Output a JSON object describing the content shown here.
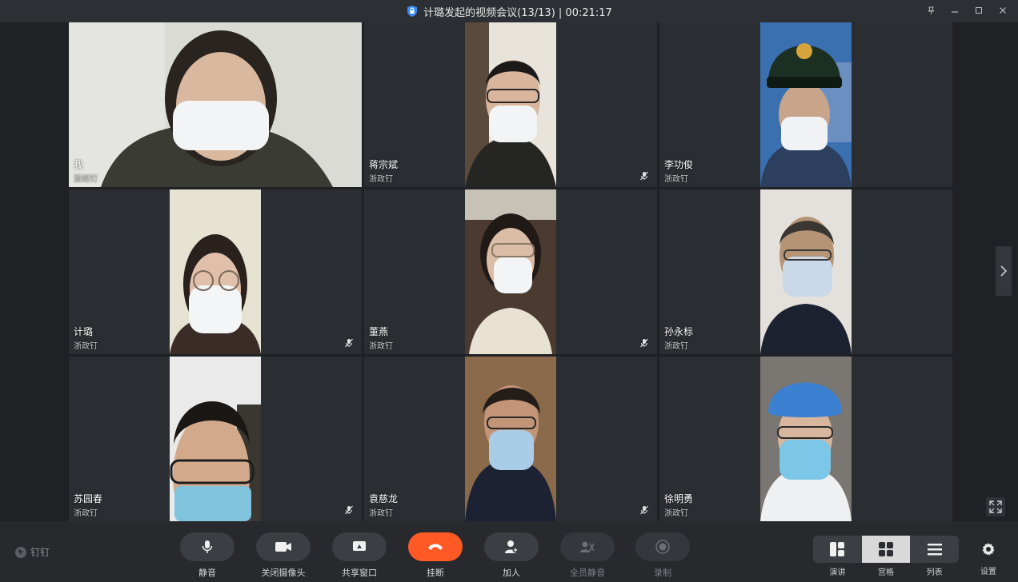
{
  "window": {
    "title": "计璐发起的视频会议(13/13) | 00:21:17",
    "controls": [
      "pin-icon",
      "minimize-icon",
      "maximize-icon",
      "close-icon"
    ]
  },
  "participants": [
    {
      "name": "我",
      "org": "浙政钉",
      "muted": false
    },
    {
      "name": "蒋宗斌",
      "org": "浙政钉",
      "muted": true
    },
    {
      "name": "李功俊",
      "org": "浙政钉",
      "muted": false
    },
    {
      "name": "计璐",
      "org": "浙政钉",
      "muted": true
    },
    {
      "name": "董燕",
      "org": "浙政钉",
      "muted": true
    },
    {
      "name": "孙永标",
      "org": "浙政钉",
      "muted": false
    },
    {
      "name": "苏园春",
      "org": "浙政钉",
      "muted": true
    },
    {
      "name": "袁慈龙",
      "org": "浙政钉",
      "muted": true
    },
    {
      "name": "徐明勇",
      "org": "浙政钉",
      "muted": false
    }
  ],
  "toolbar": {
    "brand": "钉钉",
    "mute_label": "静音",
    "camera_label": "关闭摄像头",
    "share_label": "共享窗口",
    "hangup_label": "挂断",
    "add_label": "加人",
    "mute_all_label": "全员静音",
    "record_label": "录制",
    "settings_label": "设置"
  },
  "view_modes": {
    "speaker_label": "演讲",
    "grid_label": "宫格",
    "list_label": "列表",
    "active": "grid"
  },
  "colors": {
    "hangup": "#ff5a26",
    "background": "#1f2124",
    "tile": "#2a2d31"
  }
}
